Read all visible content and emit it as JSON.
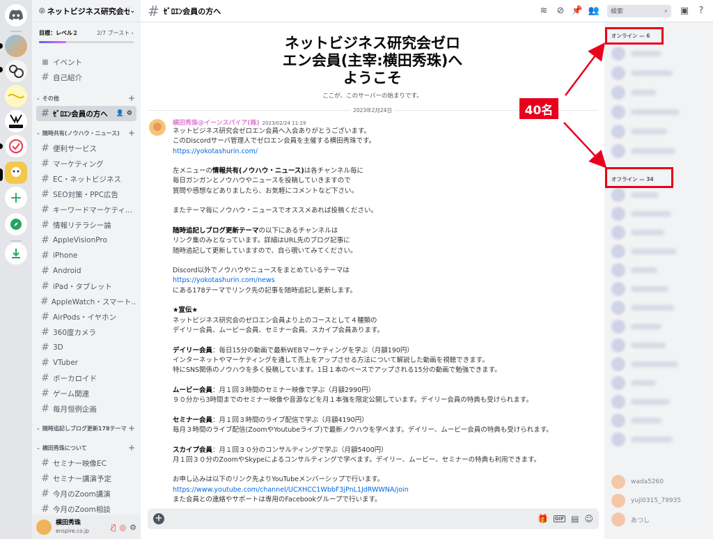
{
  "server": {
    "name": "ネットビジネス研究会ゼロエ",
    "boost_goal": "目標：レベル２",
    "boost_count": "2/7 ブースト",
    "boost_progress": 0.29
  },
  "sidebar": {
    "events_label": "イベント",
    "top_items": [
      {
        "label": "自己紹介"
      }
    ],
    "categories": [
      {
        "label": "その他",
        "channels": [
          {
            "label": "ｾﾞﾛｴﾝ会員の方へ",
            "active": true
          }
        ]
      },
      {
        "label": "随時共有(ノウハウ・ニュース)",
        "channels": [
          {
            "label": "便利サービス"
          },
          {
            "label": "マーケティング"
          },
          {
            "label": "EC・ネットビジネス"
          },
          {
            "label": "SEO対策・PPC広告"
          },
          {
            "label": "キーワードマーケティ..."
          },
          {
            "label": "情報リテラシー論"
          },
          {
            "label": "AppleVisionPro"
          },
          {
            "label": "iPhone"
          },
          {
            "label": "Android"
          },
          {
            "label": "iPad・タブレット"
          },
          {
            "label": "AppleWatch・スマート..."
          },
          {
            "label": "AirPods・イヤホン"
          },
          {
            "label": "360度カメラ"
          },
          {
            "label": "3D"
          },
          {
            "label": "VTuber"
          },
          {
            "label": "ボーカロイド"
          },
          {
            "label": "ゲーム関連"
          },
          {
            "label": "毎月恒例企画"
          }
        ]
      },
      {
        "label": "随時追記しブログ更新178テーマ",
        "channels": []
      },
      {
        "label": "横田秀珠について",
        "channels": [
          {
            "label": "セミナー映像EC"
          },
          {
            "label": "セミナー講演予定"
          },
          {
            "label": "今月のZoom講演"
          },
          {
            "label": "今月のZoom相談"
          }
        ]
      }
    ]
  },
  "user_panel": {
    "name": "横田秀珠",
    "sub": "enspire.co.jp"
  },
  "topbar": {
    "channel_name": "ｾﾞﾛｴﾝ会員の方へ",
    "search_placeholder": "検索"
  },
  "welcome": {
    "title": "ネットビジネス研究会ゼロエン会員(主宰:横田秀珠)へようこそ",
    "subtitle": "ここが、このサーバーの始まりです。",
    "date_divider": "2023年2月24日"
  },
  "message": {
    "author": "横田秀珠@イーンスパイア(株)",
    "timestamp": "2023/02/24 11:19",
    "lines": [
      {
        "t": "ネットビジネス研究会ゼロエン会員へ入会ありがとうございます。"
      },
      {
        "t": "このDiscordサーバ管理人でゼロエン会員を主催する横田秀珠です。"
      },
      {
        "t": "https://yokotashurin.com/",
        "link": true
      },
      {
        "t": ""
      },
      {
        "pre": "左メニューの",
        "b": "情報共有(ノウハウ・ニュース)",
        "t": "は各チャンネル毎に"
      },
      {
        "t": "毎日ガンガンとノウハウやニュースを投稿していきますので"
      },
      {
        "t": "質問や感想などありましたら、お気軽にコメントなど下さい。"
      },
      {
        "t": ""
      },
      {
        "t": "またテーマ毎にノウハウ・ニュースでオススメあれば投稿ください。"
      },
      {
        "t": ""
      },
      {
        "b": "随時追記しブログ更新テーマ",
        "t": "の以下にあるチャンネルは"
      },
      {
        "t": "リンク集のみとなっています。詳細はURL先のブログ記事に"
      },
      {
        "t": "随時追記して更新していますので、自ら覗いてみてください。"
      },
      {
        "t": ""
      },
      {
        "t": "Discord以外でノウハウやニュースをまとめているテーマは"
      },
      {
        "t": "https://yokotashurin.com/news",
        "link": true
      },
      {
        "t": "にある178テーマでリンク先の記事を随時追記し更新します。"
      },
      {
        "t": ""
      },
      {
        "b": "★宣伝★",
        "t": ""
      },
      {
        "t": "ネットビジネス研究会のゼロエン会員より上のコースとして４種類の"
      },
      {
        "t": "デイリー会員、ムービー会員、セミナー会員、スカイプ会員あります。"
      },
      {
        "t": ""
      },
      {
        "b": "デイリー会員",
        "t": "：毎日15分の動画で最新WEBマーケティングを学ぶ（月額190円）"
      },
      {
        "t": "インターネットやマーケティングを通して売上をアップさせる方法について解説した動画を視聴できます。"
      },
      {
        "t": "特にSNS関係のノウハウを多く投稿しています。1日１本のペースでアップされる15分の動画で勉強できます。"
      },
      {
        "t": ""
      },
      {
        "b": "ムービー会員",
        "t": "：月１回３時間のセミナー映像で学ぶ（月額2990円）"
      },
      {
        "t": "９０分から3時間までのセミナー映像や音源などを月１本強を限定公開しています。デイリー会員の特典も受けられます。"
      },
      {
        "t": ""
      },
      {
        "b": "セミナー会員",
        "t": "：月１回３時間のライブ配信で学ぶ（月額4190円）"
      },
      {
        "t": "毎月３時間のライブ配信(ZoomやYoutubeライブ)で最新ノウハウを学べます。デイリー、ムービー会員の特典も受けられます。"
      },
      {
        "t": ""
      },
      {
        "b": "スカイプ会員",
        "t": "：月１回３０分のコンサルティングで学ぶ（月額5400円）"
      },
      {
        "t": "月１回３０分のZoomやSkypeによるコンサルティングで学べます。デイリー、ムービー、セミナーの特典も利用できます。"
      },
      {
        "t": ""
      },
      {
        "t": "お申し込みは以下のリンク先よりYouTubeメンバーシップで行います。"
      },
      {
        "t": "https://www.youtube.com/channel/UCXHCC1WbbF3jPnL1JdRWWNA/join",
        "link": true
      },
      {
        "t": "また会員との連絡やサポートは専用のFacebookグループで行います。"
      }
    ]
  },
  "members": {
    "online_header": "オンライン — 6",
    "offline_header": "オフライン — 34",
    "visible_names": [
      "wada5260",
      "yuji0315_79935",
      "あつし"
    ]
  },
  "annotation": {
    "badge": "40名",
    "color": "#e8001c"
  },
  "colors": {
    "accent": "#5865f2",
    "link": "#0068e0",
    "author": "#e07bd0"
  }
}
